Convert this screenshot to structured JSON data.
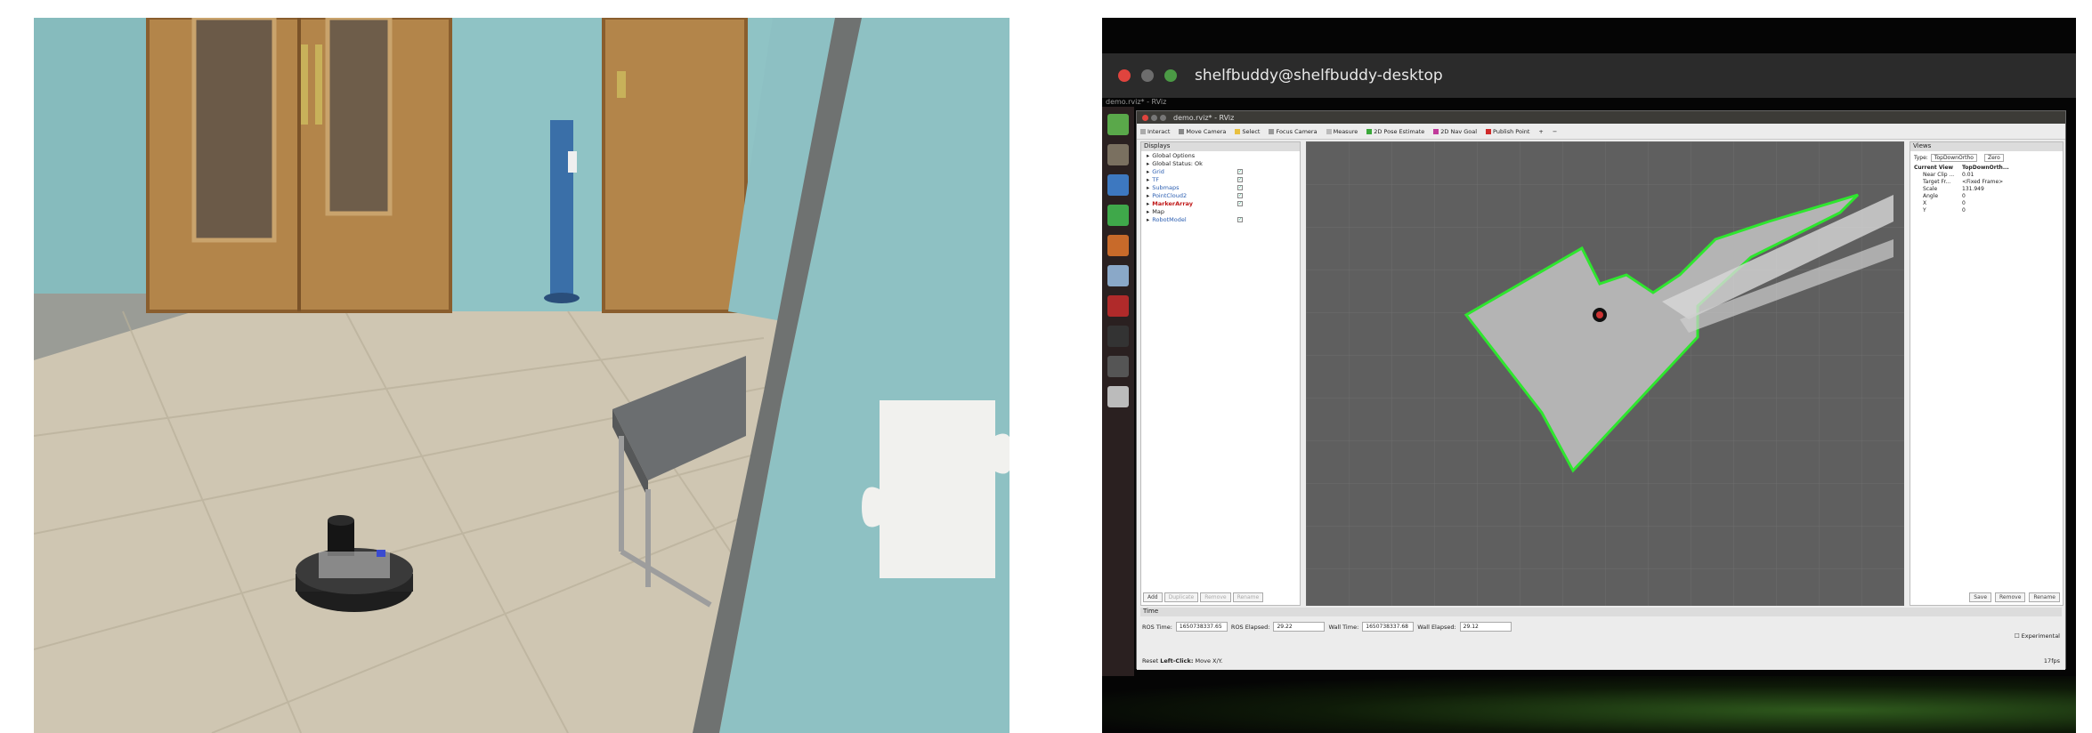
{
  "terminal": {
    "title": "shelfbuddy@shelfbuddy-desktop",
    "subtitle": "demo.rviz* - RViz"
  },
  "rviz": {
    "window_title": "demo.rviz* - RViz",
    "toolbar": {
      "interact": "Interact",
      "move_camera": "Move Camera",
      "select": "Select",
      "focus_camera": "Focus Camera",
      "measure": "Measure",
      "pose_estimate": "2D Pose Estimate",
      "nav_goal": "2D Nav Goal",
      "publish_point": "Publish Point"
    },
    "displays": {
      "header": "Displays",
      "items": [
        {
          "label": "Global Options",
          "style": "normal",
          "check": ""
        },
        {
          "label": "Global Status: Ok",
          "style": "normal",
          "check": ""
        },
        {
          "label": "Grid",
          "style": "blue",
          "check": "✓"
        },
        {
          "label": "TF",
          "style": "blue",
          "check": "✓"
        },
        {
          "label": "Submaps",
          "style": "blue",
          "check": "✓"
        },
        {
          "label": "PointCloud2",
          "style": "blue",
          "check": "✓"
        },
        {
          "label": "MarkerArray",
          "style": "red",
          "check": "✓"
        },
        {
          "label": "Map",
          "style": "normal",
          "check": ""
        },
        {
          "label": "RobotModel",
          "style": "blue",
          "check": "✓"
        }
      ],
      "buttons": {
        "add": "Add",
        "duplicate": "Duplicate",
        "remove": "Remove",
        "rename": "Rename"
      }
    },
    "views": {
      "header": "Views",
      "type_label": "Type:",
      "type_value": "TopDownOrtho",
      "zero": "Zero",
      "current_view": "Current View",
      "current_view_value": "TopDownOrth...",
      "props": [
        {
          "k": "Near Clip ...",
          "v": "0.01"
        },
        {
          "k": "Target Fr...",
          "v": "<Fixed Frame>"
        },
        {
          "k": "Scale",
          "v": "131.949"
        },
        {
          "k": "Angle",
          "v": "0"
        },
        {
          "k": "X",
          "v": "0"
        },
        {
          "k": "Y",
          "v": "0"
        }
      ],
      "buttons": {
        "save": "Save",
        "remove": "Remove",
        "rename": "Rename"
      }
    },
    "time": {
      "header": "Time",
      "ros_time_label": "ROS Time:",
      "ros_time": "1650738337.65",
      "ros_elapsed_label": "ROS Elapsed:",
      "ros_elapsed": "29.22",
      "wall_time_label": "Wall Time:",
      "wall_time": "1650738337.68",
      "wall_elapsed_label": "Wall Elapsed:",
      "wall_elapsed": "29.12",
      "experimental": "Experimental"
    },
    "status": {
      "reset": "Reset",
      "hint_bold": "Left-Click:",
      "hint": "Move X/Y.",
      "fps": "17fps"
    }
  },
  "colors": {
    "map_edge": "#2ee62e",
    "view_bg": "#5f5f5f",
    "map_fill": "#b8b8b8"
  }
}
